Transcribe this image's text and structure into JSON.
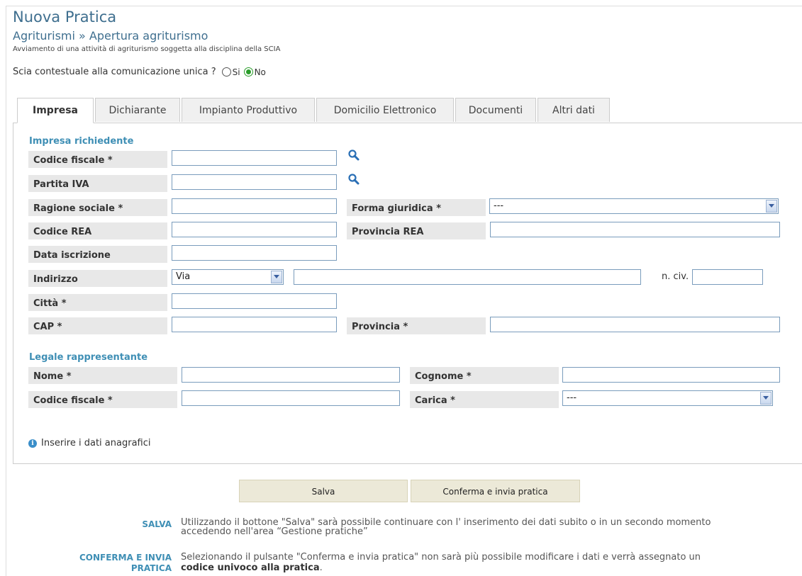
{
  "header": {
    "title": "Nuova Pratica",
    "subtitle": "Agriturismi » Apertura agriturismo",
    "description": "Avviamento di una attività di agriturismo soggetta alla disciplina della SCIA"
  },
  "scia": {
    "question": "Scia contestuale alla comunicazione unica ?",
    "option_yes": "Si",
    "option_no": "No",
    "selected": "No"
  },
  "tabs": [
    {
      "label": "Impresa",
      "active": true
    },
    {
      "label": "Dichiarante"
    },
    {
      "label": "Impianto Produttivo"
    },
    {
      "label": "Domicilio Elettronico"
    },
    {
      "label": "Documenti"
    },
    {
      "label": "Altri dati"
    }
  ],
  "impresa": {
    "section_title": "Impresa richiedente",
    "codice_fiscale": {
      "label": "Codice fiscale *",
      "value": ""
    },
    "partita_iva": {
      "label": "Partita IVA",
      "value": ""
    },
    "ragione_sociale": {
      "label": "Ragione sociale *",
      "value": ""
    },
    "forma_giuridica": {
      "label": "Forma giuridica *",
      "value": "---"
    },
    "codice_rea": {
      "label": "Codice REA",
      "value": ""
    },
    "provincia_rea": {
      "label": "Provincia REA",
      "value": ""
    },
    "data_iscrizione": {
      "label": "Data iscrizione",
      "value": ""
    },
    "indirizzo": {
      "label": "Indirizzo",
      "tipo": "Via",
      "value": "",
      "civ_label": "n. civ.",
      "civ_value": ""
    },
    "citta": {
      "label": "Città *",
      "value": ""
    },
    "cap": {
      "label": "CAP *",
      "value": ""
    },
    "provincia": {
      "label": "Provincia *",
      "value": ""
    }
  },
  "legale": {
    "section_title": "Legale rappresentante",
    "nome": {
      "label": "Nome *",
      "value": ""
    },
    "cognome": {
      "label": "Cognome *",
      "value": ""
    },
    "codice_fiscale": {
      "label": "Codice fiscale *",
      "value": ""
    },
    "carica": {
      "label": "Carica *",
      "value": "---"
    }
  },
  "info_text": "Inserire i dati anagrafici",
  "buttons": {
    "save": "Salva",
    "confirm": "Conferma e invia pratica"
  },
  "help": {
    "salva_key": "SALVA",
    "salva_line1": "Utilizzando il bottone \"Salva\" sarà possibile continuare con l' inserimento dei dati subito o in un secondo momento",
    "salva_line2": "accedendo nell'area “Gestione pratiche”",
    "conferma_key_line1": "CONFERMA E INVIA",
    "conferma_key_line2": "PRATICA",
    "conferma_line1": "Selezionando il pulsante \"Conferma e invia pratica\" non sarà più possibile modificare i dati e verrà assegnato un",
    "conferma_line2_bold": "codice univoco alla pratica",
    "conferma_line2_end": "."
  }
}
